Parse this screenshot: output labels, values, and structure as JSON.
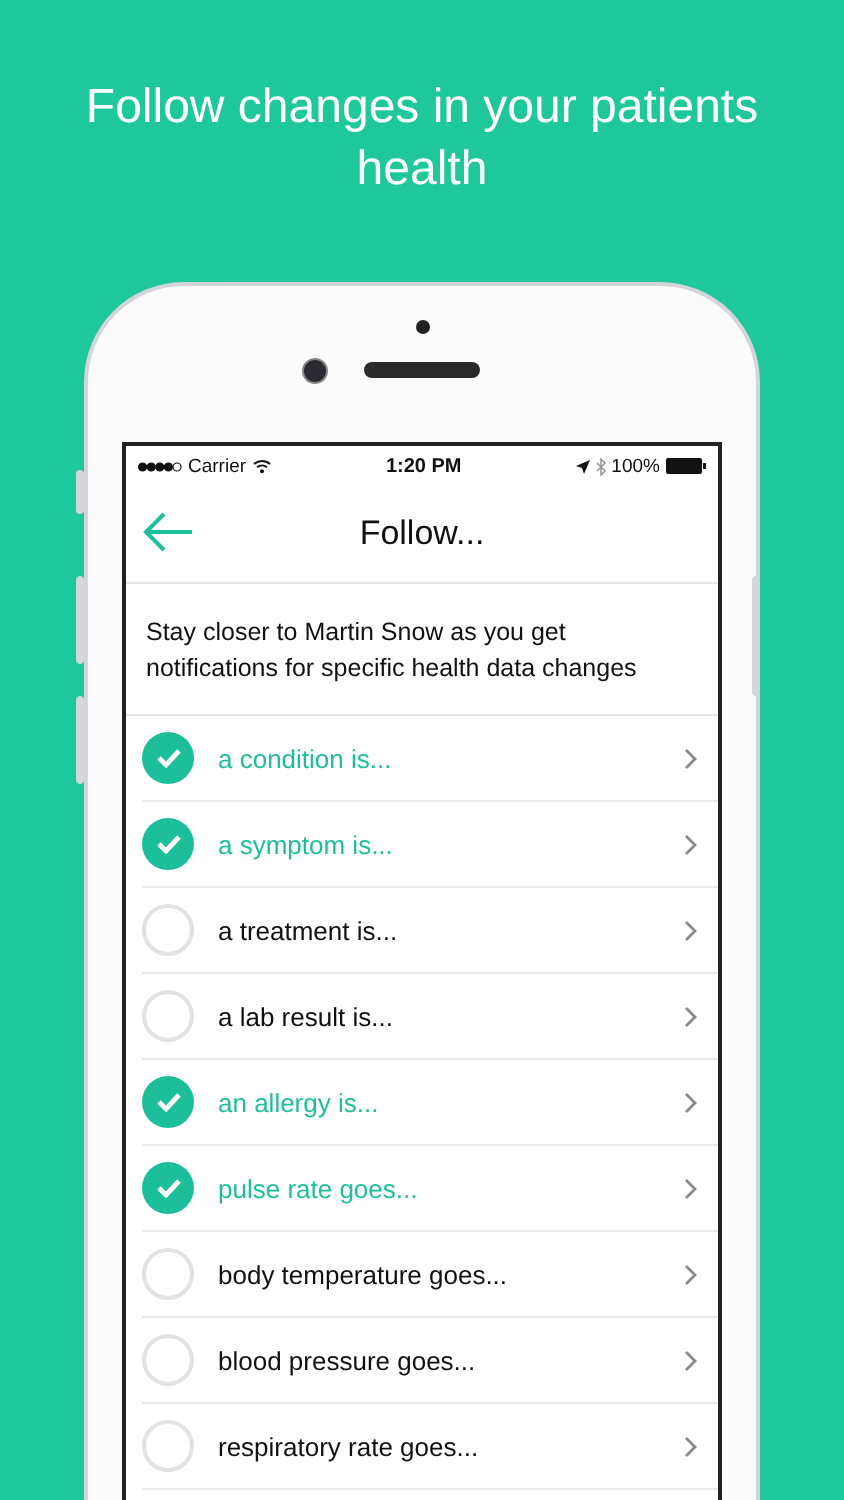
{
  "headline": "Follow changes in your patients health",
  "status_bar": {
    "carrier": "Carrier",
    "time": "1:20 PM",
    "battery": "100%"
  },
  "header": {
    "title": "Follow..."
  },
  "description": "Stay closer to Martin Snow as you get notifications for specific health data changes",
  "items": [
    {
      "label": "a condition is...",
      "checked": true
    },
    {
      "label": "a symptom is...",
      "checked": true
    },
    {
      "label": "a treatment is...",
      "checked": false
    },
    {
      "label": "a lab result is...",
      "checked": false
    },
    {
      "label": "an allergy is...",
      "checked": true
    },
    {
      "label": "pulse rate goes...",
      "checked": true
    },
    {
      "label": "body temperature goes...",
      "checked": false
    },
    {
      "label": "blood pressure goes...",
      "checked": false
    },
    {
      "label": "respiratory rate goes...",
      "checked": false
    }
  ]
}
